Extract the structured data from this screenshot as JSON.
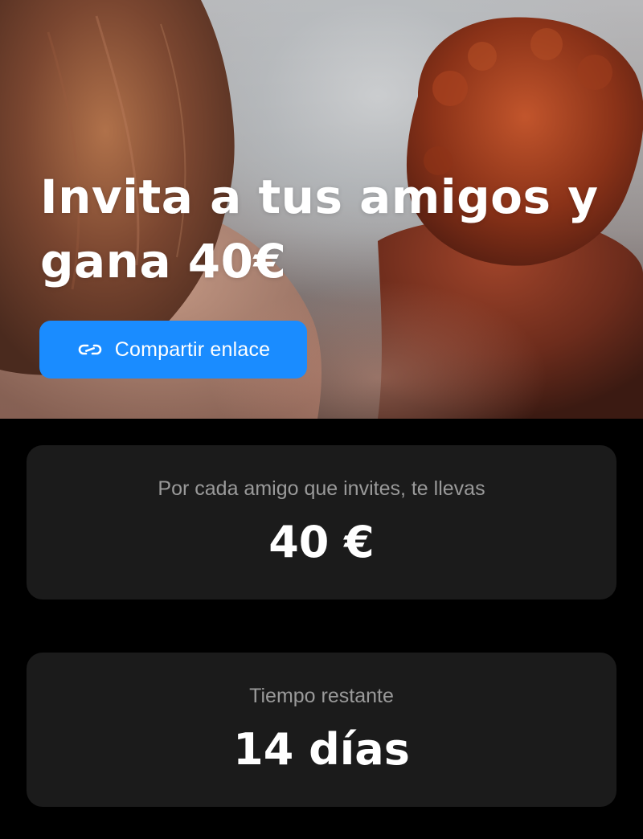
{
  "hero": {
    "title_line1": "Invita a tus amigos y",
    "title_line2": "gana 40€",
    "share_button": {
      "label": "Compartir enlace",
      "icon": "link-icon",
      "color": "#1a8cff"
    }
  },
  "reward_card": {
    "label": "Por cada amigo que invites, te llevas",
    "value": "40 €"
  },
  "time_card": {
    "label": "Tiempo restante",
    "value": "14 días"
  },
  "colors": {
    "background": "#000000",
    "card": "#1b1b1b",
    "accent": "#1a8cff",
    "muted_text": "#9a9a9a"
  }
}
